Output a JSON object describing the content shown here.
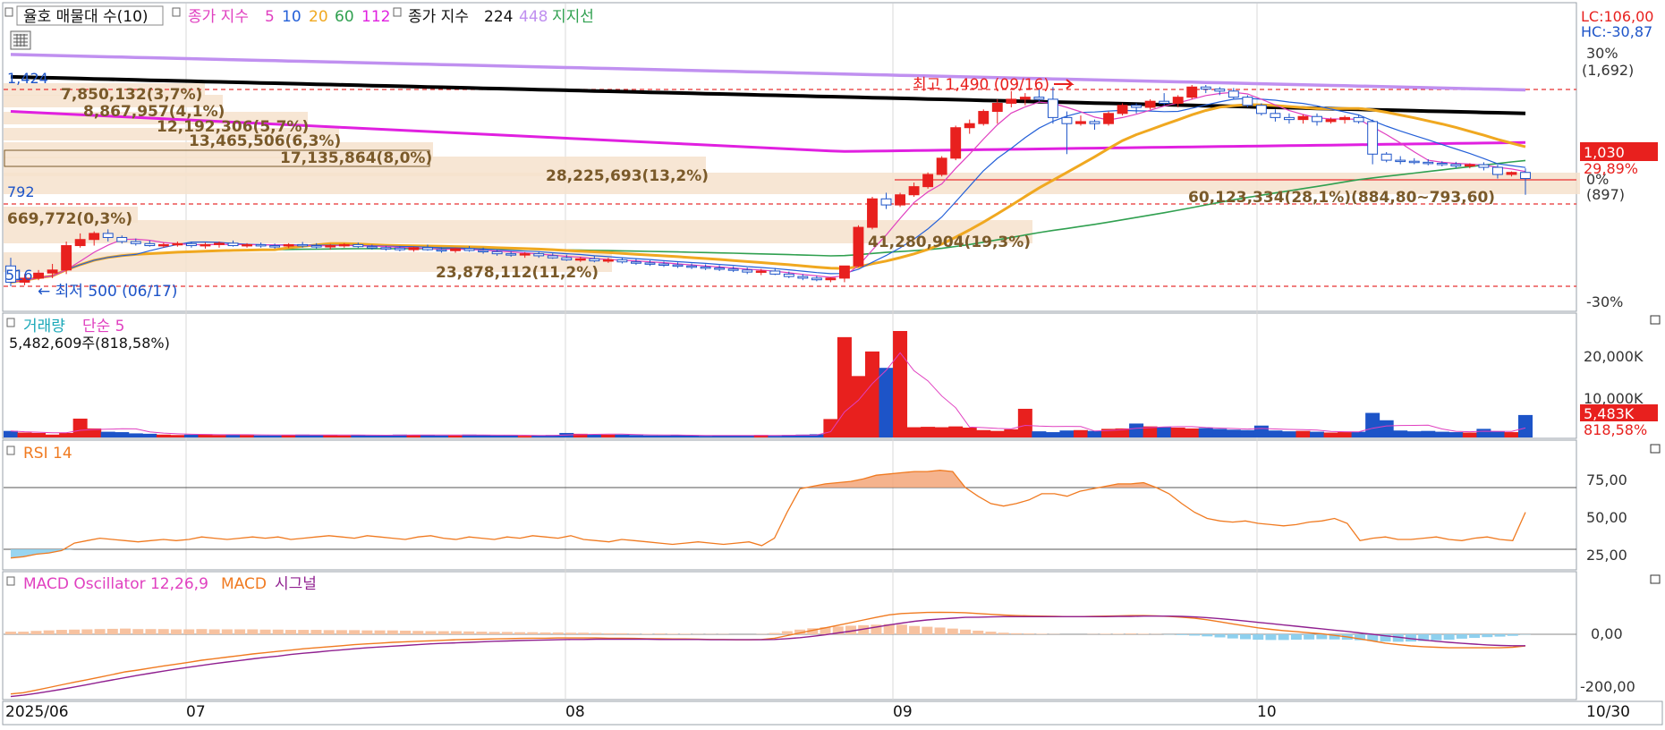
{
  "colors": {
    "up": "#e8201e",
    "down": "#1d54c8",
    "grid": "#d9d9d9",
    "ma5": "#e040c0",
    "ma10": "#2460d8",
    "ma20": "#f0a820",
    "ma60": "#30a050",
    "ma112": "#e020e0",
    "ma224": "#000000",
    "ma448": "#c090f0",
    "rsi": "#f07a20",
    "macd": "#f07a20",
    "signal": "#902090",
    "osc_pos": "#f7c2a0",
    "osc_neg": "#8ed0ee",
    "profile": "#f6e2cc",
    "dash": "#e83030",
    "label_brown": "#7a5a2a",
    "right_red": "#e8201e",
    "right_blue": "#1d54c8"
  },
  "legend": {
    "main": {
      "box1": "율호 매물대 수(10)",
      "ma_prefix": "종가 지수",
      "ma5": "5",
      "ma10": "10",
      "ma20": "20",
      "ma60": "60",
      "ma112": "112",
      "ma_prefix2": "종가 지수",
      "ma224": "224",
      "ma448": "448",
      "support": "지지선"
    },
    "volume": {
      "name": "거래량",
      "ma": "단순 5",
      "value": "5,482,609주(818,58%)"
    },
    "rsi": {
      "name": "RSI 14"
    },
    "macd": {
      "name": "MACD Oscillator 12,26,9",
      "macd": "MACD",
      "signal": "시그널"
    }
  },
  "right_axis": {
    "lc": "LC:106,00",
    "hc": "HC:-30,87",
    "price_ticks": [
      "30%",
      "(1,692)",
      "0%",
      "(897)",
      "-30%"
    ],
    "current_price": "1,030",
    "current_pct": "29,89%",
    "volume_ticks": [
      "20,000K",
      "10,000K"
    ],
    "volume_box": "5,483K",
    "volume_pct": "818,58%",
    "rsi_ticks": [
      "75,00",
      "50,00",
      "25,00"
    ],
    "macd_ticks": [
      "0,00",
      "-200,00"
    ]
  },
  "annotations": {
    "high": "최고 1,490 (09/16)",
    "low": "← 최저 500 (06/17)",
    "left_1424": "1,424",
    "left_792": "792",
    "left_516": "516",
    "profile_labels": [
      "7,850,132(3,7%)",
      "8,867,957(4,1%)",
      "12,192,306(5,7%)",
      "13,465,506(6,3%)",
      "17,135,864(8,0%)",
      "28,225,693(13,2%)",
      "669,772(0,3%)",
      "41,280,904(19,3%)",
      "23,878,112(11,2%)",
      "60,123,334(28,1%)(884,80~793,60)"
    ]
  },
  "x_axis": {
    "labels": [
      "2025/06",
      "07",
      "08",
      "09",
      "10",
      "10/30"
    ]
  },
  "chart_data": [
    {
      "type": "candlestick",
      "title": "율호",
      "x_labels": [
        "2025/06",
        "07",
        "08",
        "09",
        "10",
        "10/30"
      ],
      "ylim": [
        480,
        1520
      ],
      "annotations": {
        "high": 1490,
        "high_date": "09/16",
        "low": 500,
        "low_date": "06/17"
      },
      "candles": [
        [
          600,
          640,
          500,
          520
        ],
        [
          520,
          560,
          505,
          540
        ],
        [
          540,
          580,
          530,
          565
        ],
        [
          565,
          610,
          540,
          580
        ],
        [
          580,
          720,
          560,
          700
        ],
        [
          700,
          760,
          690,
          730
        ],
        [
          730,
          770,
          700,
          760
        ],
        [
          760,
          780,
          720,
          740
        ],
        [
          740,
          750,
          710,
          720
        ],
        [
          720,
          735,
          700,
          710
        ],
        [
          710,
          725,
          695,
          700
        ],
        [
          700,
          715,
          690,
          705
        ],
        [
          705,
          720,
          695,
          710
        ],
        [
          710,
          720,
          690,
          700
        ],
        [
          700,
          715,
          685,
          705
        ],
        [
          705,
          720,
          690,
          712
        ],
        [
          712,
          725,
          695,
          700
        ],
        [
          700,
          712,
          690,
          705
        ],
        [
          705,
          715,
          690,
          700
        ],
        [
          700,
          710,
          685,
          698
        ],
        [
          698,
          712,
          688,
          705
        ],
        [
          705,
          718,
          690,
          700
        ],
        [
          700,
          712,
          685,
          695
        ],
        [
          695,
          708,
          680,
          700
        ],
        [
          700,
          712,
          690,
          705
        ],
        [
          705,
          715,
          688,
          695
        ],
        [
          695,
          705,
          680,
          690
        ],
        [
          690,
          700,
          675,
          688
        ],
        [
          688,
          698,
          672,
          680
        ],
        [
          680,
          695,
          670,
          690
        ],
        [
          690,
          705,
          675,
          680
        ],
        [
          680,
          692,
          665,
          675
        ],
        [
          675,
          690,
          665,
          685
        ],
        [
          685,
          698,
          670,
          676
        ],
        [
          676,
          690,
          660,
          670
        ],
        [
          670,
          680,
          650,
          660
        ],
        [
          660,
          672,
          645,
          655
        ],
        [
          655,
          668,
          640,
          660
        ],
        [
          660,
          670,
          640,
          650
        ],
        [
          650,
          662,
          635,
          640
        ],
        [
          640,
          655,
          625,
          630
        ],
        [
          630,
          645,
          620,
          635
        ],
        [
          635,
          648,
          618,
          625
        ],
        [
          625,
          640,
          615,
          630
        ],
        [
          630,
          642,
          612,
          620
        ],
        [
          620,
          635,
          605,
          615
        ],
        [
          615,
          628,
          600,
          610
        ],
        [
          610,
          622,
          595,
          605
        ],
        [
          605,
          618,
          590,
          600
        ],
        [
          600,
          612,
          585,
          595
        ],
        [
          595,
          608,
          580,
          590
        ],
        [
          590,
          603,
          575,
          585
        ],
        [
          585,
          598,
          570,
          580
        ],
        [
          580,
          592,
          560,
          570
        ],
        [
          570,
          585,
          555,
          575
        ],
        [
          575,
          590,
          555,
          560
        ],
        [
          560,
          572,
          540,
          548
        ],
        [
          548,
          560,
          530,
          540
        ],
        [
          540,
          552,
          525,
          532
        ],
        [
          532,
          545,
          520,
          540
        ],
        [
          540,
          560,
          520,
          600
        ],
        [
          600,
          800,
          595,
          790
        ],
        [
          790,
          940,
          780,
          930
        ],
        [
          930,
          960,
          880,
          900
        ],
        [
          900,
          960,
          890,
          950
        ],
        [
          950,
          1010,
          940,
          990
        ],
        [
          990,
          1060,
          980,
          1050
        ],
        [
          1050,
          1140,
          1040,
          1130
        ],
        [
          1130,
          1290,
          1120,
          1280
        ],
        [
          1280,
          1320,
          1250,
          1300
        ],
        [
          1300,
          1370,
          1290,
          1360
        ],
        [
          1360,
          1420,
          1300,
          1400
        ],
        [
          1400,
          1460,
          1380,
          1420
        ],
        [
          1420,
          1450,
          1390,
          1430
        ],
        [
          1430,
          1470,
          1410,
          1420
        ],
        [
          1420,
          1480,
          1300,
          1330
        ],
        [
          1330,
          1360,
          1150,
          1300
        ],
        [
          1300,
          1340,
          1290,
          1310
        ],
        [
          1310,
          1320,
          1270,
          1300
        ],
        [
          1300,
          1360,
          1290,
          1350
        ],
        [
          1350,
          1400,
          1340,
          1390
        ],
        [
          1390,
          1400,
          1350,
          1380
        ],
        [
          1380,
          1420,
          1370,
          1410
        ],
        [
          1410,
          1450,
          1390,
          1400
        ],
        [
          1400,
          1440,
          1380,
          1430
        ],
        [
          1430,
          1490,
          1420,
          1480
        ],
        [
          1480,
          1490,
          1450,
          1470
        ],
        [
          1470,
          1480,
          1440,
          1460
        ],
        [
          1460,
          1475,
          1420,
          1430
        ],
        [
          1430,
          1440,
          1380,
          1390
        ],
        [
          1390,
          1400,
          1340,
          1350
        ],
        [
          1350,
          1370,
          1310,
          1330
        ],
        [
          1330,
          1350,
          1300,
          1320
        ],
        [
          1320,
          1345,
          1300,
          1335
        ],
        [
          1335,
          1350,
          1290,
          1310
        ],
        [
          1310,
          1330,
          1300,
          1320
        ],
        [
          1320,
          1340,
          1300,
          1330
        ],
        [
          1330,
          1345,
          1300,
          1310
        ],
        [
          1310,
          1320,
          1100,
          1150
        ],
        [
          1150,
          1160,
          1110,
          1120
        ],
        [
          1120,
          1140,
          1100,
          1115
        ],
        [
          1115,
          1130,
          1100,
          1110
        ],
        [
          1110,
          1125,
          1095,
          1105
        ],
        [
          1105,
          1115,
          1090,
          1100
        ],
        [
          1100,
          1112,
          1080,
          1092
        ],
        [
          1092,
          1105,
          1080,
          1098
        ],
        [
          1098,
          1110,
          1070,
          1085
        ],
        [
          1085,
          1098,
          1030,
          1050
        ],
        [
          1050,
          1065,
          1040,
          1060
        ],
        [
          1060,
          1080,
          950,
          1030
        ]
      ]
    },
    {
      "type": "bar",
      "title": "거래량",
      "ylim": [
        0,
        26000
      ],
      "values": [
        1600,
        1200,
        1100,
        700,
        1100,
        4600,
        2200,
        1400,
        1300,
        1000,
        900,
        700,
        600,
        700,
        800,
        600,
        700,
        600,
        500,
        500,
        600,
        700,
        600,
        600,
        500,
        600,
        500,
        500,
        700,
        600,
        600,
        500,
        500,
        700,
        600,
        500,
        500,
        400,
        500,
        600,
        1100,
        900,
        700,
        700,
        700,
        600,
        500,
        500,
        600,
        500,
        400,
        500,
        500,
        500,
        600,
        400,
        600,
        700,
        800,
        4500,
        24500,
        15000,
        21000,
        17000,
        26000,
        2500,
        2600,
        2500,
        2700,
        2400,
        1800,
        1600,
        2000,
        7000,
        1500,
        1300,
        1700,
        1800,
        1600,
        2100,
        2200,
        3400,
        2700,
        2500,
        2400,
        2200,
        2300,
        2100,
        1900,
        1800,
        2900,
        1700,
        1500,
        1600,
        1400,
        1200,
        1300,
        1400,
        6000,
        4200,
        1700,
        1500,
        1600,
        1400,
        1300,
        1200,
        2100,
        1500,
        1300,
        5483
      ],
      "value_text": "5,482,609주(818,58%)"
    },
    {
      "type": "line",
      "title": "RSI 14",
      "ylim": [
        15,
        95
      ],
      "values": [
        18,
        19,
        21,
        22,
        24,
        30,
        32,
        34,
        33,
        32,
        31,
        32,
        33,
        32,
        33,
        35,
        34,
        33,
        34,
        35,
        34,
        35,
        33,
        34,
        35,
        36,
        35,
        34,
        36,
        35,
        34,
        33,
        35,
        36,
        34,
        33,
        35,
        34,
        33,
        35,
        34,
        36,
        35,
        34,
        36,
        33,
        32,
        31,
        33,
        32,
        31,
        30,
        29,
        30,
        31,
        30,
        29,
        30,
        31,
        28,
        34,
        55,
        74,
        76,
        78,
        79,
        80,
        82,
        85,
        86,
        87,
        88,
        88,
        89,
        88,
        75,
        68,
        62,
        60,
        62,
        65,
        70,
        70,
        68,
        72,
        74,
        76,
        78,
        78,
        79,
        75,
        70,
        62,
        55,
        50,
        48,
        47,
        48,
        46,
        45,
        44,
        45,
        47,
        48,
        50,
        46,
        32,
        34,
        35,
        33,
        33,
        34,
        35,
        33,
        32,
        34,
        35,
        33,
        32,
        55
      ],
      "ticks": [
        75,
        50,
        25
      ]
    },
    {
      "type": "line",
      "title": "MACD Oscillator 12,26,9",
      "ylim": [
        -240,
        80
      ],
      "series": [
        {
          "name": "MACD",
          "values": [
            -230,
            -225,
            -215,
            -205,
            -195,
            -185,
            -175,
            -165,
            -155,
            -145,
            -138,
            -130,
            -122,
            -115,
            -108,
            -100,
            -94,
            -88,
            -82,
            -76,
            -71,
            -66,
            -61,
            -56,
            -52,
            -48,
            -44,
            -40,
            -37,
            -34,
            -31,
            -29,
            -27,
            -25,
            -23,
            -21,
            -20,
            -19,
            -18,
            -17,
            -16,
            -15,
            -15,
            -14,
            -14,
            -14,
            -14,
            -15,
            -15,
            -16,
            -17,
            -17,
            -18,
            -18,
            -19,
            -20,
            -20,
            -21,
            -21,
            -20,
            -15,
            -5,
            5,
            15,
            25,
            35,
            45,
            55,
            65,
            75,
            80,
            82,
            84,
            85,
            84,
            83,
            80,
            77,
            74,
            72,
            71,
            70,
            69,
            68,
            68,
            69,
            70,
            71,
            72,
            72,
            71,
            69,
            66,
            62,
            56,
            48,
            40,
            32,
            25,
            19,
            14,
            10,
            6,
            2,
            -4,
            -10,
            -18,
            -26,
            -34,
            -40,
            -45,
            -48,
            -50,
            -52,
            -52,
            -52,
            -52,
            -52,
            -50,
            -45
          ]
        },
        {
          "name": "시그널",
          "values": [
            -240,
            -235,
            -228,
            -220,
            -212,
            -203,
            -194,
            -185,
            -176,
            -167,
            -158,
            -150,
            -142,
            -134,
            -127,
            -120,
            -113,
            -107,
            -101,
            -95,
            -89,
            -84,
            -78,
            -73,
            -69,
            -64,
            -60,
            -56,
            -52,
            -49,
            -46,
            -43,
            -40,
            -37,
            -35,
            -33,
            -31,
            -29,
            -27,
            -26,
            -24,
            -23,
            -22,
            -21,
            -20,
            -20,
            -19,
            -19,
            -19,
            -19,
            -19,
            -20,
            -20,
            -20,
            -20,
            -21,
            -21,
            -21,
            -21,
            -21,
            -20,
            -17,
            -13,
            -8,
            -2,
            5,
            12,
            20,
            28,
            36,
            43,
            50,
            55,
            59,
            62,
            65,
            66,
            67,
            68,
            68,
            68,
            68,
            68,
            68,
            68,
            68,
            68,
            69,
            69,
            70,
            70,
            70,
            69,
            67,
            64,
            60,
            56,
            51,
            46,
            41,
            36,
            31,
            26,
            21,
            16,
            11,
            5,
            0,
            -6,
            -11,
            -17,
            -22,
            -27,
            -31,
            -35,
            -38,
            -41,
            -43,
            -44,
            -44
          ]
        }
      ],
      "ticks": [
        0,
        -200
      ]
    }
  ]
}
